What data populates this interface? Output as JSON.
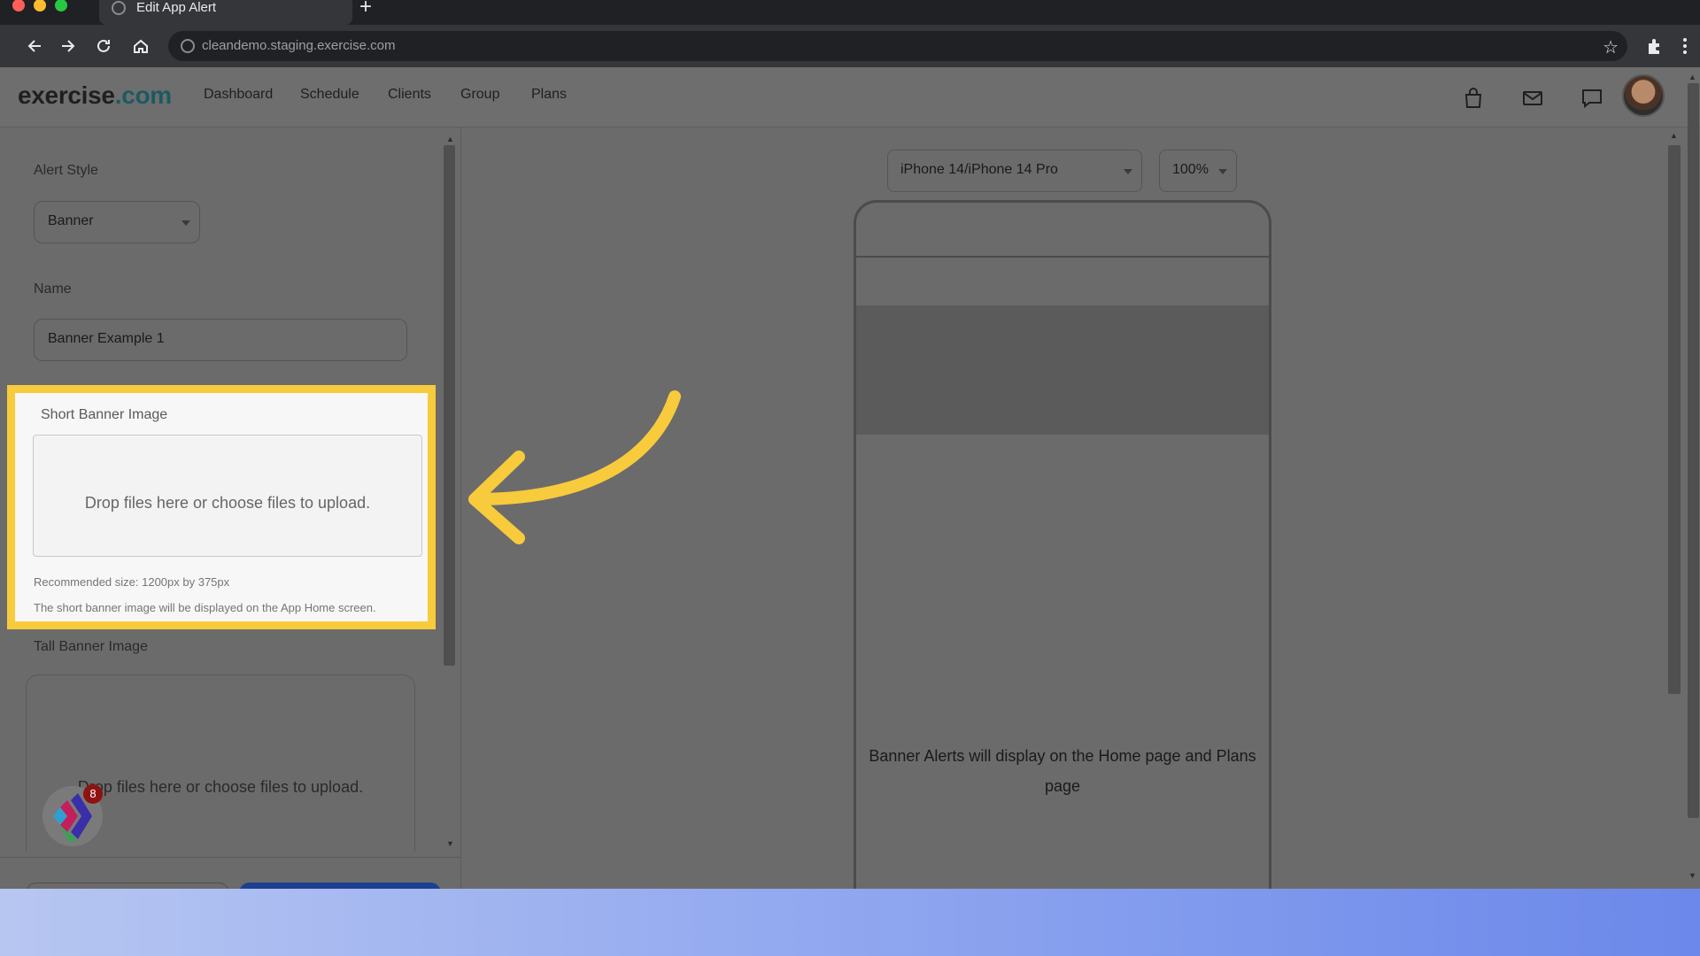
{
  "browser": {
    "tab_title": "Edit App Alert",
    "new_tab_icon": "+",
    "url": "cleandemo.staging.exercise.com"
  },
  "header": {
    "logo_main": "exercise",
    "logo_suffix": ".com",
    "nav": [
      "Dashboard",
      "Schedule",
      "Clients",
      "Group",
      "Plans"
    ]
  },
  "form": {
    "alert_style_label": "Alert Style",
    "alert_style_value": "Banner",
    "name_label": "Name",
    "name_value": "Banner Example 1",
    "short_banner": {
      "label": "Short Banner Image",
      "drop_text": "Drop files here or choose files to upload.",
      "recommended": "Recommended size: 1200px by 375px",
      "note": "The short banner image will be displayed on the App Home screen."
    },
    "tall_banner": {
      "label": "Tall Banner Image",
      "drop_text": "Drop files here or choose files to upload."
    }
  },
  "widget": {
    "badge_count": "8"
  },
  "preview": {
    "device": "iPhone 14/iPhone 14 Pro",
    "zoom": "100%",
    "message": "Banner Alerts will display on the Home page and Plans page"
  },
  "colors": {
    "highlight": "#f8cb3c",
    "logo_accent": "#1c5a63",
    "save_button": "#1c3f8f"
  }
}
